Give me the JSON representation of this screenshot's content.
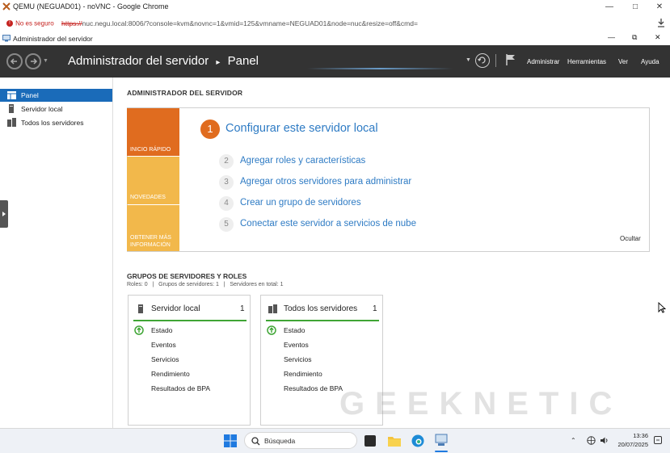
{
  "chrome": {
    "window_title": "QEMU (NEGUAD01) - noVNC - Google Chrome",
    "security_label": "No es seguro",
    "url_protocol": "https://",
    "url_rest": "nuc.negu.local:8006/?console=kvm&novnc=1&vmid=125&vmname=NEGUAD01&node=nuc&resize=off&cmd="
  },
  "inner_window": {
    "title": "Administrador del servidor"
  },
  "header": {
    "breadcrumb_root": "Administrador del servidor",
    "breadcrumb_sep": "▸",
    "breadcrumb_page": "Panel",
    "menu": [
      "Administrar",
      "Herramientas",
      "Ver",
      "Ayuda"
    ]
  },
  "sidebar": {
    "items": [
      {
        "label": "Panel",
        "icon": "dashboard-icon",
        "active": true
      },
      {
        "label": "Servidor local",
        "icon": "server-icon",
        "active": false
      },
      {
        "label": "Todos los servidores",
        "icon": "servers-icon",
        "active": false
      }
    ]
  },
  "main": {
    "heading": "ADMINISTRADOR DEL SERVIDOR",
    "tabs": [
      "INICIO RÁPIDO",
      "NOVEDADES",
      "OBTENER MÁS INFORMACIÓN"
    ],
    "tab_colors": [
      "#e06c1f",
      "#f2b84b",
      "#f2b84b"
    ],
    "steps": [
      {
        "num": "1",
        "label": "Configurar este servidor local"
      },
      {
        "num": "2",
        "label": "Agregar roles y características"
      },
      {
        "num": "3",
        "label": "Agregar otros servidores para administrar"
      },
      {
        "num": "4",
        "label": "Crear un grupo de servidores"
      },
      {
        "num": "5",
        "label": "Conectar este servidor a servicios de nube"
      }
    ],
    "hide_label": "Ocultar",
    "groups_heading": "GRUPOS DE SERVIDORES Y ROLES",
    "groups_sub": "Roles: 0   |   Grupos de servidores: 1   |   Servidores en total: 1",
    "tiles": [
      {
        "title": "Servidor local",
        "count": "1",
        "rows": [
          "Estado",
          "Eventos",
          "Servicios",
          "Rendimiento",
          "Resultados de BPA"
        ]
      },
      {
        "title": "Todos los servidores",
        "count": "1",
        "rows": [
          "Estado",
          "Eventos",
          "Servicios",
          "Rendimiento",
          "Resultados de BPA"
        ]
      }
    ]
  },
  "watermark": "GEEKNETIC",
  "taskbar": {
    "search_placeholder": "Búsqueda",
    "time": "13:36",
    "date": "20/07/2025"
  },
  "colors": {
    "accent": "#1a6bb9",
    "link": "#2e7bc4",
    "orange": "#e06c1f",
    "green": "#3fa535"
  }
}
